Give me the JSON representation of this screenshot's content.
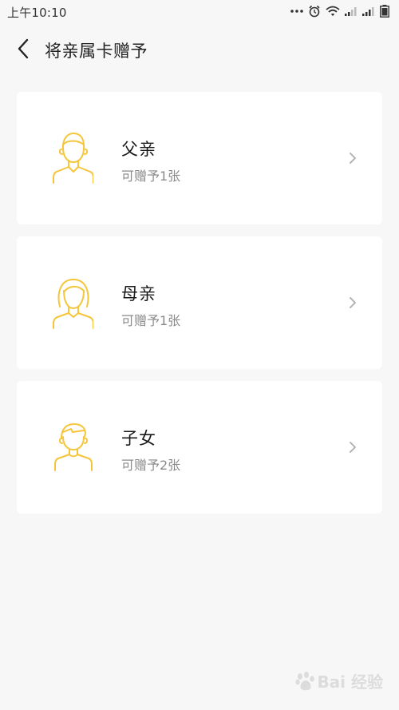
{
  "status_bar": {
    "time": "上午10:10",
    "icons": [
      "more-dots-icon",
      "alarm-icon",
      "wifi-icon",
      "signal-icon",
      "signal-icon",
      "battery-icon"
    ]
  },
  "header": {
    "back_icon": "chevron-left-icon",
    "title": "将亲属卡赠予"
  },
  "cards": [
    {
      "name": "父亲",
      "subtitle": "可赠予1张",
      "avatar_icon": "father-avatar-icon"
    },
    {
      "name": "母亲",
      "subtitle": "可赠予1张",
      "avatar_icon": "mother-avatar-icon"
    },
    {
      "name": "子女",
      "subtitle": "可赠予2张",
      "avatar_icon": "child-avatar-icon"
    }
  ],
  "colors": {
    "background": "#f7f7f7",
    "card": "#ffffff",
    "avatar_line": "#f5c53a",
    "subtitle": "#8a8a8a",
    "chevron": "#b5b5b5"
  },
  "watermark": {
    "text": "Bai 经验"
  }
}
